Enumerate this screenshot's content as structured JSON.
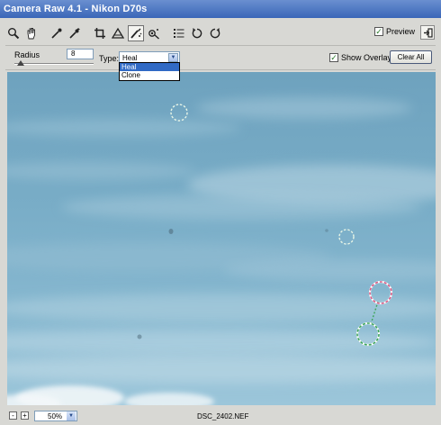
{
  "window": {
    "title": "Camera Raw 4.1  -  Nikon D70s"
  },
  "toolbar": {
    "tools": [
      "zoom-icon",
      "hand-icon",
      "white-balance-icon",
      "color-sampler-icon",
      "crop-icon",
      "straighten-icon",
      "spot-removal-icon",
      "red-eye-icon",
      "presets-icon",
      "rotate-left-icon",
      "rotate-right-icon"
    ],
    "active_tool": "spot-removal-icon",
    "preview_label": "Preview",
    "preview_checked": true
  },
  "options": {
    "radius_label": "Radius",
    "radius_value": "8",
    "type_label": "Type:",
    "type_value": "Heal",
    "type_options": [
      "Heal",
      "Clone"
    ],
    "show_overlay_label": "Show Overlay",
    "show_overlay_checked": true,
    "clear_all_label": "Clear All"
  },
  "status": {
    "zoom_out": "-",
    "zoom_in": "+",
    "zoom_value": "50%",
    "filename": "DSC_2402.NEF"
  },
  "colors": {
    "heal_target": "#e7f5e7",
    "heal_source": "#d85a84",
    "heal_link": "#3ea65a"
  }
}
